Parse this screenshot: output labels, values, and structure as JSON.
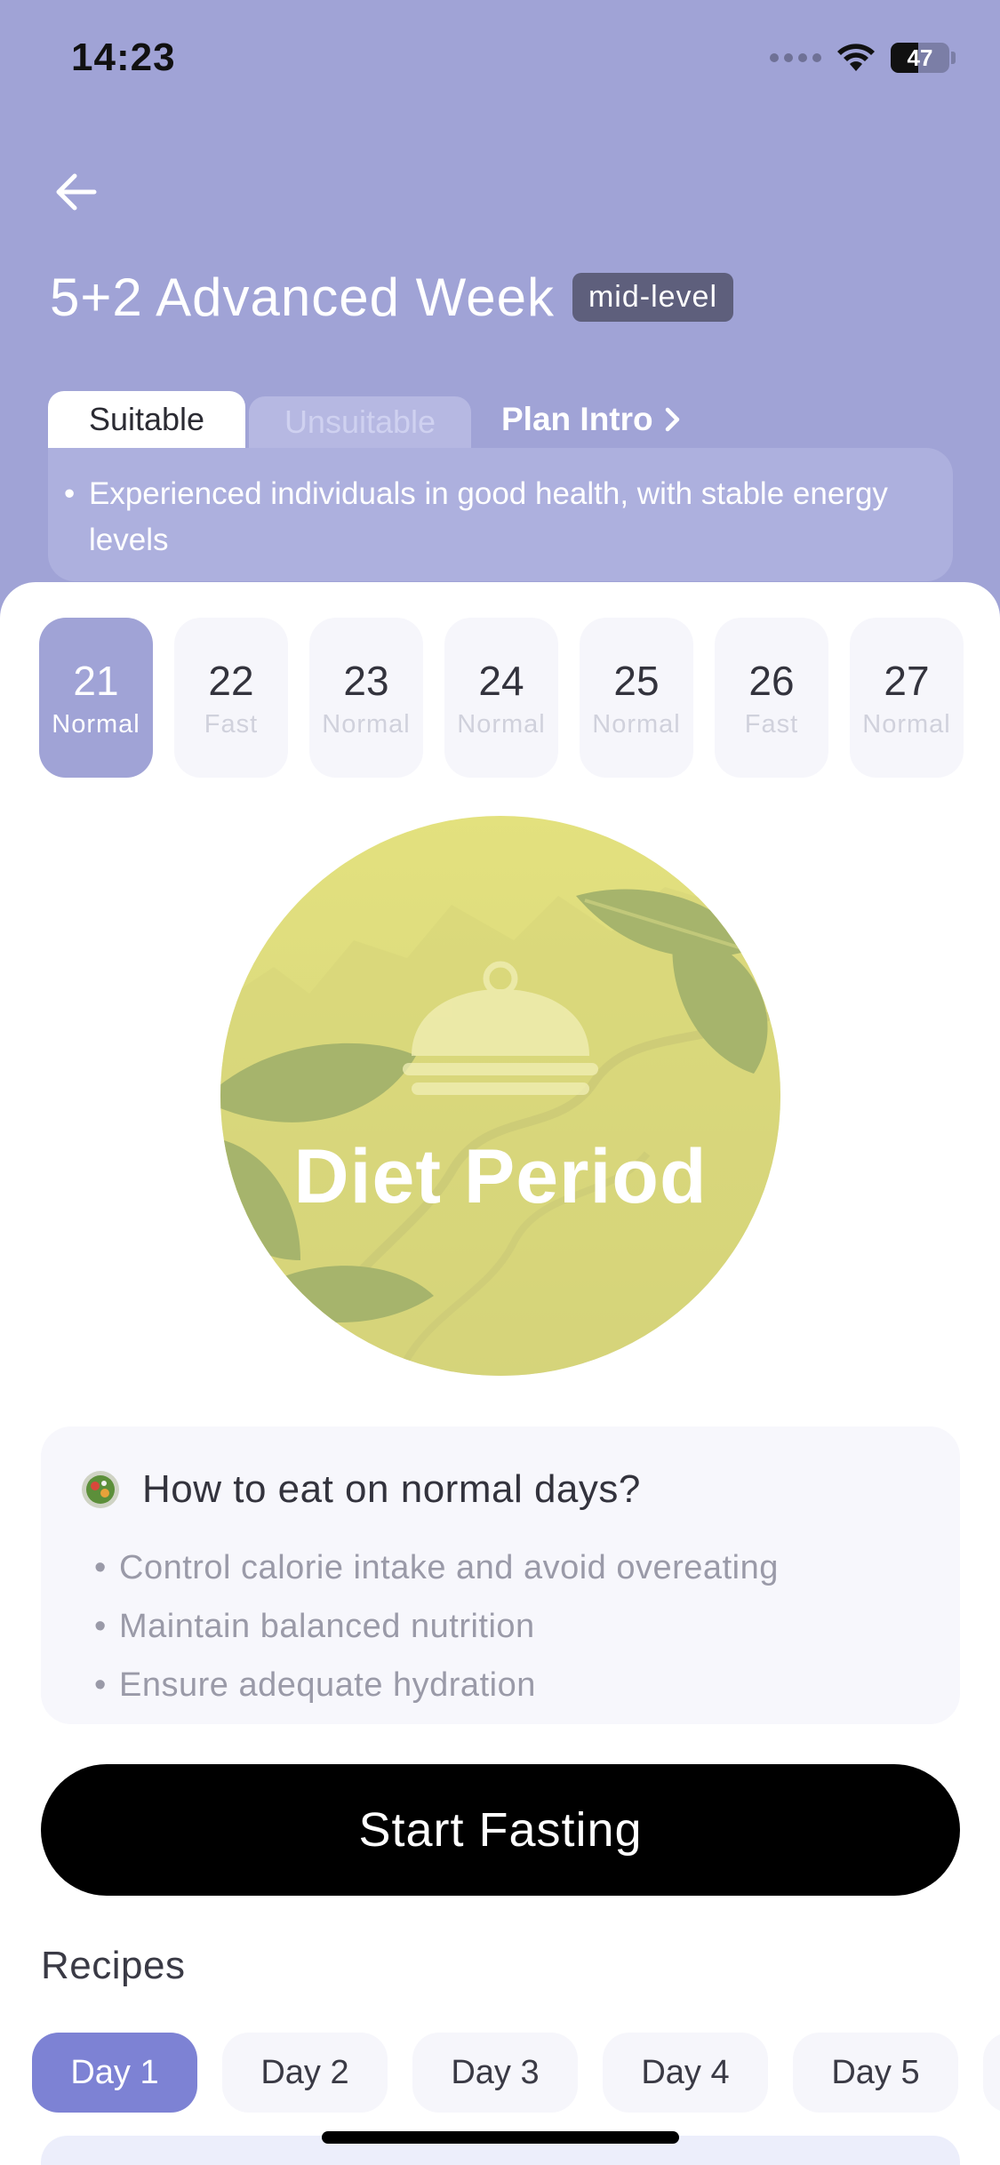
{
  "status": {
    "time": "14:23",
    "battery": "47"
  },
  "plan": {
    "title": "5+2 Advanced Week",
    "level": "mid-level"
  },
  "tabs": {
    "suitable": "Suitable",
    "unsuitable": "Unsuitable",
    "plan_intro": "Plan Intro"
  },
  "intro_text": "Experienced individuals in good health, with stable energy levels",
  "days": [
    {
      "num": "21",
      "label": "Normal"
    },
    {
      "num": "22",
      "label": "Fast"
    },
    {
      "num": "23",
      "label": "Normal"
    },
    {
      "num": "24",
      "label": "Normal"
    },
    {
      "num": "25",
      "label": "Normal"
    },
    {
      "num": "26",
      "label": "Fast"
    },
    {
      "num": "27",
      "label": "Normal"
    }
  ],
  "selected_day": "21",
  "period_label": "Diet Period",
  "tips": {
    "title": "How to eat on normal days?",
    "items": [
      "Control calorie intake and avoid overeating",
      "Maintain balanced nutrition",
      "Ensure adequate hydration"
    ]
  },
  "start_button": "Start Fasting",
  "recipes": {
    "title": "Recipes",
    "days": [
      "Day 1",
      "Day 2",
      "Day 3",
      "Day 4",
      "Day 5"
    ],
    "selected": "Day 1"
  },
  "colors": {
    "hero": "#a0a3d6",
    "accent": "#7d82d4",
    "circle": "#d8d67a",
    "button": "#000000"
  },
  "icons": [
    "back-arrow-icon",
    "chevron-right-icon",
    "cloche-icon",
    "salad-icon",
    "wifi-icon",
    "signal-icon",
    "battery-icon"
  ]
}
